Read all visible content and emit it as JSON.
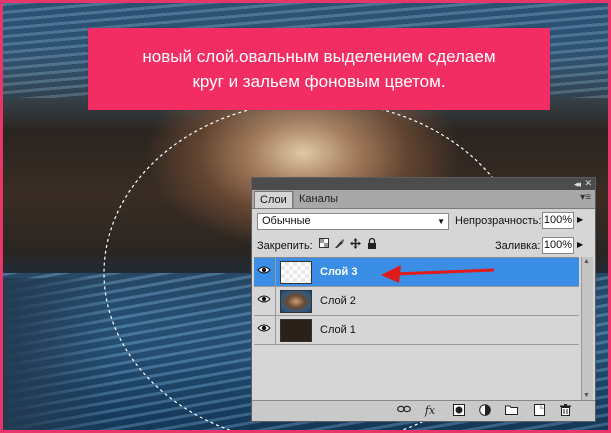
{
  "banner": {
    "line1": "новый слой.овальным выделением сделаем",
    "line2": "круг и  зальем фоновым цветом."
  },
  "panel": {
    "tabs": [
      {
        "label": "Слои",
        "active": true
      },
      {
        "label": "Каналы",
        "active": false
      }
    ],
    "blend_mode": "Обычные",
    "opacity_label": "Непрозрачность:",
    "opacity_value": "100%",
    "lock_label": "Закрепить:",
    "fill_label": "Заливка:",
    "fill_value": "100%",
    "layers": [
      {
        "name": "Слой 3",
        "thumbnail": "transparent",
        "selected": true,
        "visible": true
      },
      {
        "name": "Слой 2",
        "thumbnail": "image",
        "selected": false,
        "visible": true
      },
      {
        "name": "Слой 1",
        "thumbnail": "dark",
        "selected": false,
        "visible": true
      }
    ],
    "lock_icons": [
      "lock-transparency-icon",
      "lock-image-icon",
      "lock-position-icon",
      "lock-all-icon"
    ],
    "bottom_icons": [
      "link-layers-icon",
      "fx-icon",
      "layer-mask-icon",
      "adjustment-layer-icon",
      "new-group-icon",
      "new-layer-icon",
      "trash-icon"
    ]
  },
  "colors": {
    "accent": "#f22d64",
    "frame": "#e8356a",
    "selection_blue": "#3a8ee6",
    "arrow_red": "#e01b1b"
  }
}
